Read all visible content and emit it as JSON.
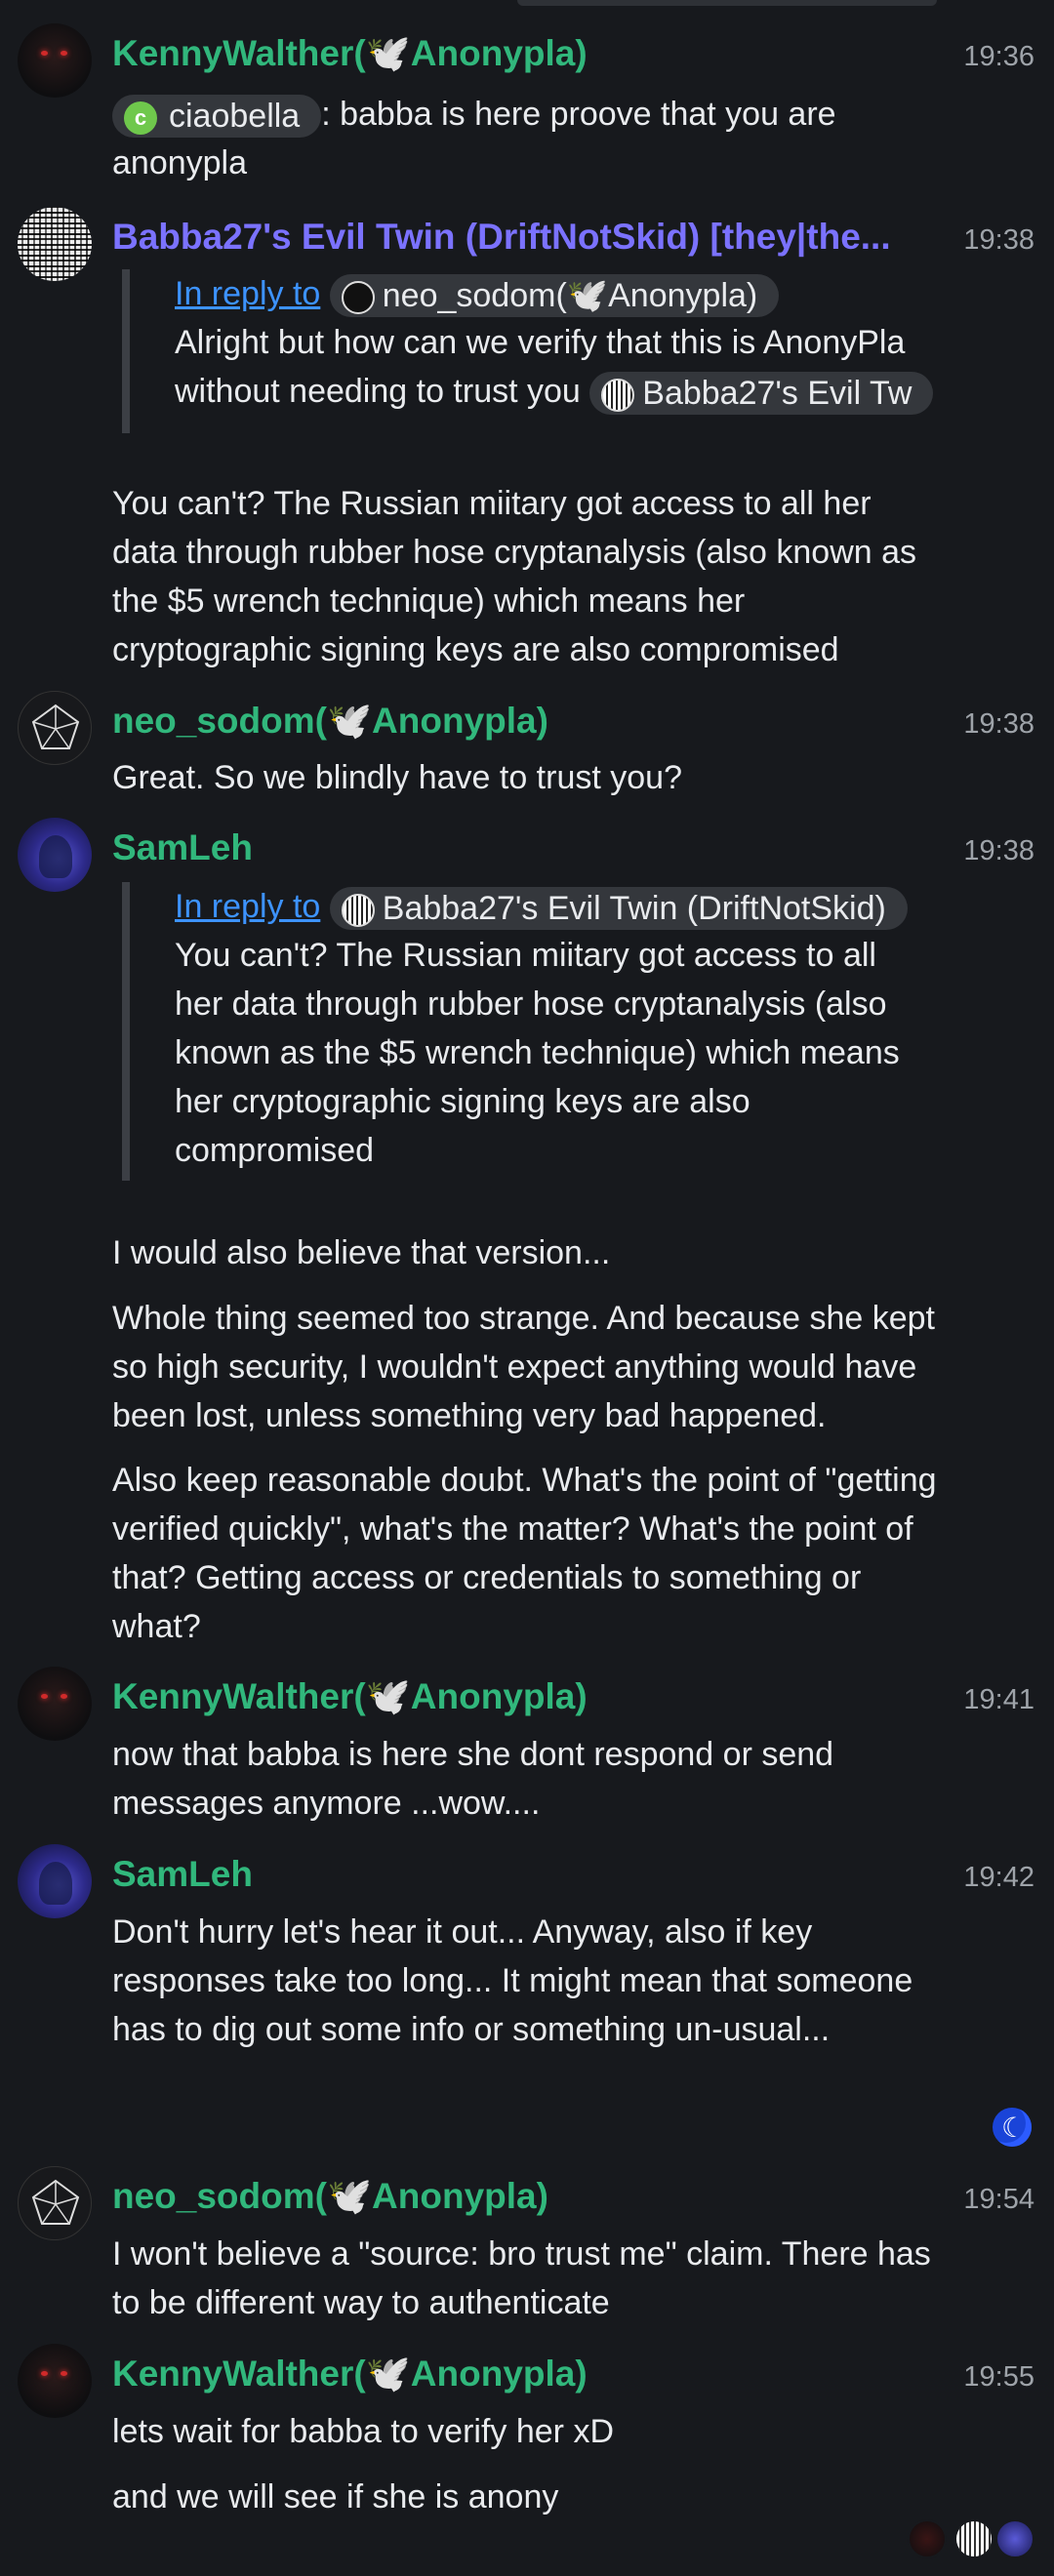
{
  "messages": [
    {
      "name_text": "KennyWalther(",
      "dove": "🕊️",
      "org": "Anonypla)",
      "time": "19:36",
      "mention": {
        "letter": "c",
        "name": "ciaobella"
      },
      "text_after": ": babba is here proove that you are anonypla"
    },
    {
      "name": "Babba27's Evil Twin (DriftNotSkid) [they|the...",
      "time": "19:38",
      "quote": {
        "reply_label": "In reply to",
        "user": "neo_sodom(",
        "user_org": "Anonypla)",
        "text": "Alright but how can we verify that this is AnonyPla without needing to trust you",
        "mention": "Babba27's Evil Tw"
      },
      "text": "You can't? The Russian miitary got access to all her data through rubber hose cryptanalysis (also known as the $5 wrench technique) which means her cryptographic signing keys are also compromised"
    },
    {
      "name_text": "neo_sodom(",
      "org": "Anonypla)",
      "time": "19:38",
      "text": "Great. So we blindly have to trust you?"
    },
    {
      "name": "SamLeh",
      "time": "19:38",
      "quote": {
        "reply_label": "In reply to",
        "user": "Babba27's Evil Twin (DriftNotSkid)",
        "text": "You can't? The Russian miitary got access to all her data through rubber hose cryptanalysis (also known as the $5 wrench technique) which means her cryptographic signing keys are also compromised"
      },
      "texts": [
        "I would also believe that version...",
        "Whole thing seemed too strange. And because she kept so high security, I wouldn't expect anything would have been lost, unless something very bad happened.",
        "Also keep reasonable doubt. What's the point of \"getting verified quickly\", what's the matter? What's the point of that? Getting access or credentials to something or what?"
      ]
    },
    {
      "name_text": "KennyWalther(",
      "org": "Anonypla)",
      "time": "19:41",
      "text": "now that babba is here she dont respond or send messages anymore ...wow...."
    },
    {
      "name": "SamLeh",
      "time": "19:42",
      "text": "Don't hurry let's hear it out... Anyway, also if key responses take too long... It might mean that someone has to dig out some info or something un-usual..."
    },
    {
      "name_text": "neo_sodom(",
      "org": "Anonypla)",
      "time": "19:54",
      "text": "I won't believe a \"source: bro trust me\" claim. There has to be different way to authenticate"
    },
    {
      "name_text": "KennyWalther(",
      "org": "Anonypla)",
      "time": "19:55",
      "texts": [
        "lets wait for babba to verify her xD",
        "and we will see if she is anony"
      ]
    }
  ],
  "colors": {
    "background": "#17191d",
    "name_green": "#31b77c",
    "name_purple": "#7b72ff",
    "link": "#3d93ff"
  },
  "icons": {
    "moon": "moon-icon"
  }
}
